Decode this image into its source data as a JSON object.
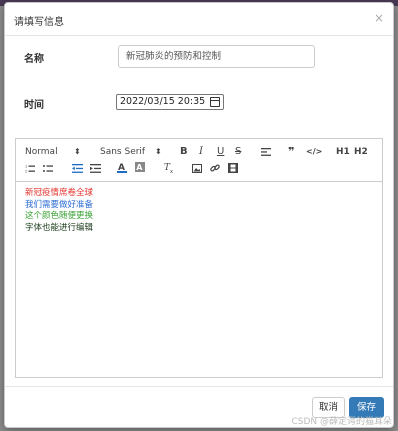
{
  "modal": {
    "title": "请填写信息",
    "close_icon": "×"
  },
  "form": {
    "name_label": "名称",
    "name_value": "新冠肺炎的预防和控制",
    "time_label": "时间",
    "time_value": "2022/03/15 20:35"
  },
  "toolbar": {
    "size_select": "Normal",
    "font_select": "Sans Serif",
    "bold": "B",
    "italic": "I",
    "underline": "U",
    "strike": "S",
    "align_icon": "align-icon",
    "quote": "❞",
    "code": "</>",
    "h1": "H1",
    "h2": "H2"
  },
  "content": {
    "lines": [
      {
        "text": "新冠疫情席卷全球",
        "color": "#e5312c"
      },
      {
        "text": "我们需要做好准备",
        "color": "#2f6ed3"
      },
      {
        "text": "这个颜色随便更换",
        "color": "#3aa336"
      },
      {
        "text": "字体也能进行编辑",
        "color": "#1a3a1a"
      }
    ]
  },
  "footer": {
    "cancel_label": "取消",
    "save_label": "保存"
  },
  "watermark": "CSDN @薛定谔的猫耳朵"
}
